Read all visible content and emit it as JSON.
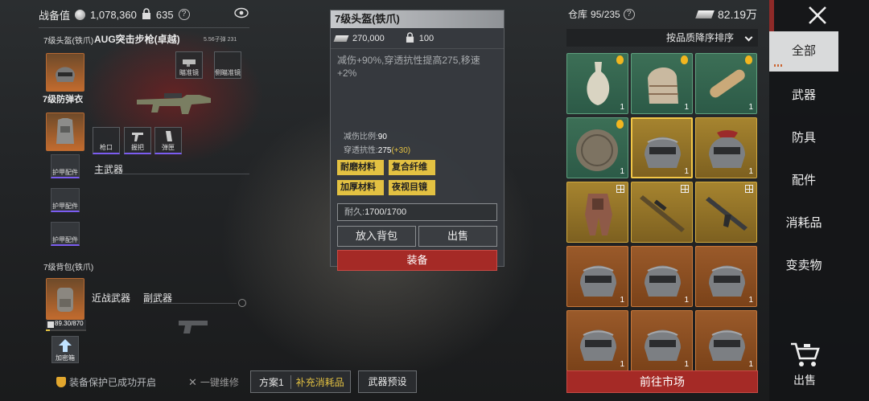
{
  "topbar": {
    "combat_value_label": "战备值",
    "combat_value": "1,078,360",
    "lock_value": "635",
    "help": "?"
  },
  "loadout": {
    "helmet_slot_label": "7级头盔(铁爪)",
    "weapon_name": "AUG突击步枪(卓越)",
    "weapon_ammo": "5.56子弹",
    "weapon_ammo_count": "231",
    "armor_label": "7级防弹衣",
    "attachments_top": [
      "瞄准镜",
      "侧瞄准镜"
    ],
    "attachments_bottom": [
      "枪口",
      "握把",
      "弹匣"
    ],
    "main_weapon_label": "主武器",
    "armor_parts_label": "护甲配件",
    "backpack_label": "7级背包(铁爪)",
    "melee_label": "近战武器",
    "secondary_label": "副武器",
    "backpack_capacity": "89.30/870",
    "case_label": "加密箱"
  },
  "popup": {
    "title": "7级头盔(铁爪)",
    "price": "270,000",
    "lock_price": "100",
    "description": "减伤+90%,穿透抗性提高275,移速+2%",
    "damage_reduction_label": "减伤比例:",
    "damage_reduction_value": "90",
    "pen_resist_label": "穿透抗性:",
    "pen_resist_value": "275",
    "pen_resist_bonus": "(+30)",
    "tags": [
      "耐磨材料",
      "复合纤维",
      "加厚材料",
      "夜视目镜"
    ],
    "durability_label": "耐久:",
    "durability_value": "1700/1700",
    "btn_put_in_bag": "放入背包",
    "btn_sell": "出售",
    "btn_equip": "装备"
  },
  "warehouse": {
    "label": "仓库",
    "capacity": "95/235",
    "help": "?",
    "money": "82.19万",
    "sort_label": "按品质降序排序",
    "go_market": "前往市场",
    "items": [
      {
        "name": "vase-icon",
        "rarity": "green",
        "count": "1",
        "badge": "gourd"
      },
      {
        "name": "coral-stone-icon",
        "rarity": "green",
        "count": "1",
        "badge": "gourd"
      },
      {
        "name": "scroll-icon",
        "rarity": "green",
        "count": "1",
        "badge": "gourd"
      },
      {
        "name": "bronze-mirror-icon",
        "rarity": "green",
        "count": "1",
        "badge": "gourd"
      },
      {
        "name": "helmet-icon",
        "rarity": "gold",
        "count": "1",
        "badge": "",
        "selected": true
      },
      {
        "name": "helmet-red-icon",
        "rarity": "gold",
        "count": "1",
        "badge": ""
      },
      {
        "name": "armor-suit-icon",
        "rarity": "gold",
        "count": "",
        "badge": "grid"
      },
      {
        "name": "sniper-rifle-icon",
        "rarity": "gold",
        "count": "",
        "badge": "grid"
      },
      {
        "name": "assault-rifle-icon",
        "rarity": "gold",
        "count": "",
        "badge": "grid"
      },
      {
        "name": "helmet-icon",
        "rarity": "orange",
        "count": "1",
        "badge": ""
      },
      {
        "name": "helmet-icon",
        "rarity": "orange",
        "count": "1",
        "badge": ""
      },
      {
        "name": "helmet-icon",
        "rarity": "orange",
        "count": "1",
        "badge": ""
      },
      {
        "name": "helmet-icon",
        "rarity": "orange",
        "count": "1",
        "badge": ""
      },
      {
        "name": "helmet-icon",
        "rarity": "orange",
        "count": "1",
        "badge": ""
      },
      {
        "name": "helmet-icon",
        "rarity": "orange",
        "count": "1",
        "badge": ""
      }
    ]
  },
  "sidebar": {
    "items": [
      "全部",
      "武器",
      "防具",
      "配件",
      "消耗品",
      "变卖物"
    ],
    "sell_label": "出售"
  },
  "bottom": {
    "protection_text": "装备保护已成功开启",
    "repair_text": "一键维修",
    "plan_label": "方案1",
    "replenish_label": "补充消耗品",
    "weapon_preset_label": "武器预设"
  }
}
